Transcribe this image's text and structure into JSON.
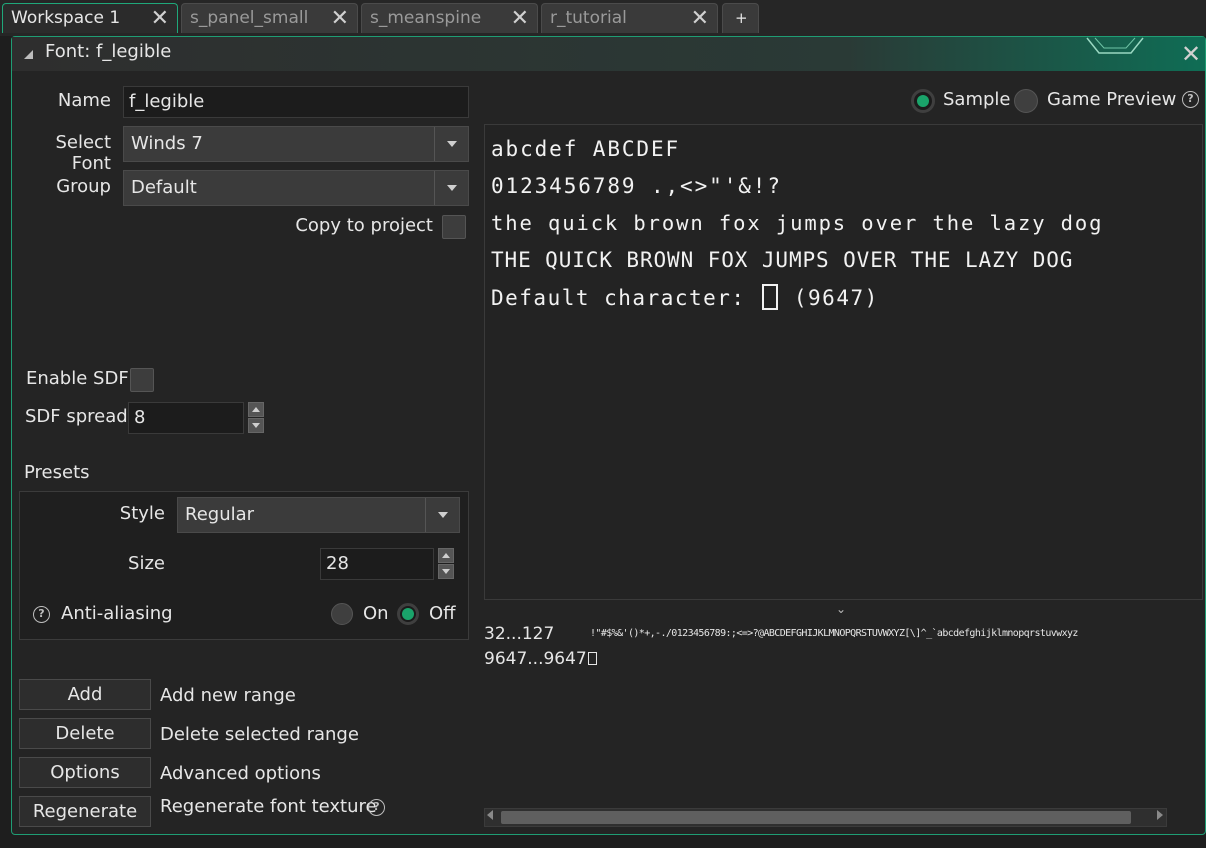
{
  "tabs": [
    {
      "label": "Workspace 1",
      "active": true
    },
    {
      "label": "s_panel_small",
      "active": false
    },
    {
      "label": "s_meanspine",
      "active": false
    },
    {
      "label": "r_tutorial",
      "active": false
    }
  ],
  "add_tab_label": "+",
  "window": {
    "title": "Font: f_legible"
  },
  "form": {
    "name_label": "Name",
    "name_value": "f_legible",
    "select_font_label": "Select Font",
    "select_font_value": "Winds 7",
    "group_label": "Group",
    "group_value": "Default",
    "copy_to_project_label": "Copy to project",
    "enable_sdf_label": "Enable SDF",
    "sdf_spread_label": "SDF spread",
    "sdf_spread_value": "8"
  },
  "presets": {
    "heading": "Presets",
    "style_label": "Style",
    "style_value": "Regular",
    "size_label": "Size",
    "size_value": "28",
    "anti_aliasing_label": "Anti-aliasing",
    "on_label": "On",
    "off_label": "Off",
    "anti_aliasing_selected": "Off"
  },
  "actions": [
    {
      "button": "Add",
      "desc": "Add new range"
    },
    {
      "button": "Delete",
      "desc": "Delete selected range"
    },
    {
      "button": "Options",
      "desc": "Advanced options"
    },
    {
      "button": "Regenerate",
      "desc": "Regenerate font texture"
    }
  ],
  "preview_mode": {
    "sample_label": "Sample",
    "game_preview_label": "Game Preview",
    "selected": "Sample"
  },
  "sample_lines": [
    "abcdef ABCDEF",
    "0123456789 .,<>\"'&!?",
    "the quick brown fox jumps over the lazy dog",
    "THE QUICK BROWN FOX JUMPS OVER THE LAZY DOG"
  ],
  "default_char": {
    "prefix": "Default character:",
    "code": "(9647)"
  },
  "ranges": [
    {
      "range": "32...127",
      "chars": "!\"#$%&'()*+,-./0123456789:;<=>?@ABCDEFGHIJKLMNOPQRSTUVWXYZ[\\]^_`abcdefghijklmnopqrstuvwxyz"
    },
    {
      "range": "9647...9647",
      "chars": ""
    }
  ],
  "colors": {
    "accent": "#1f9d74",
    "radio_on": "#1aa36a"
  }
}
